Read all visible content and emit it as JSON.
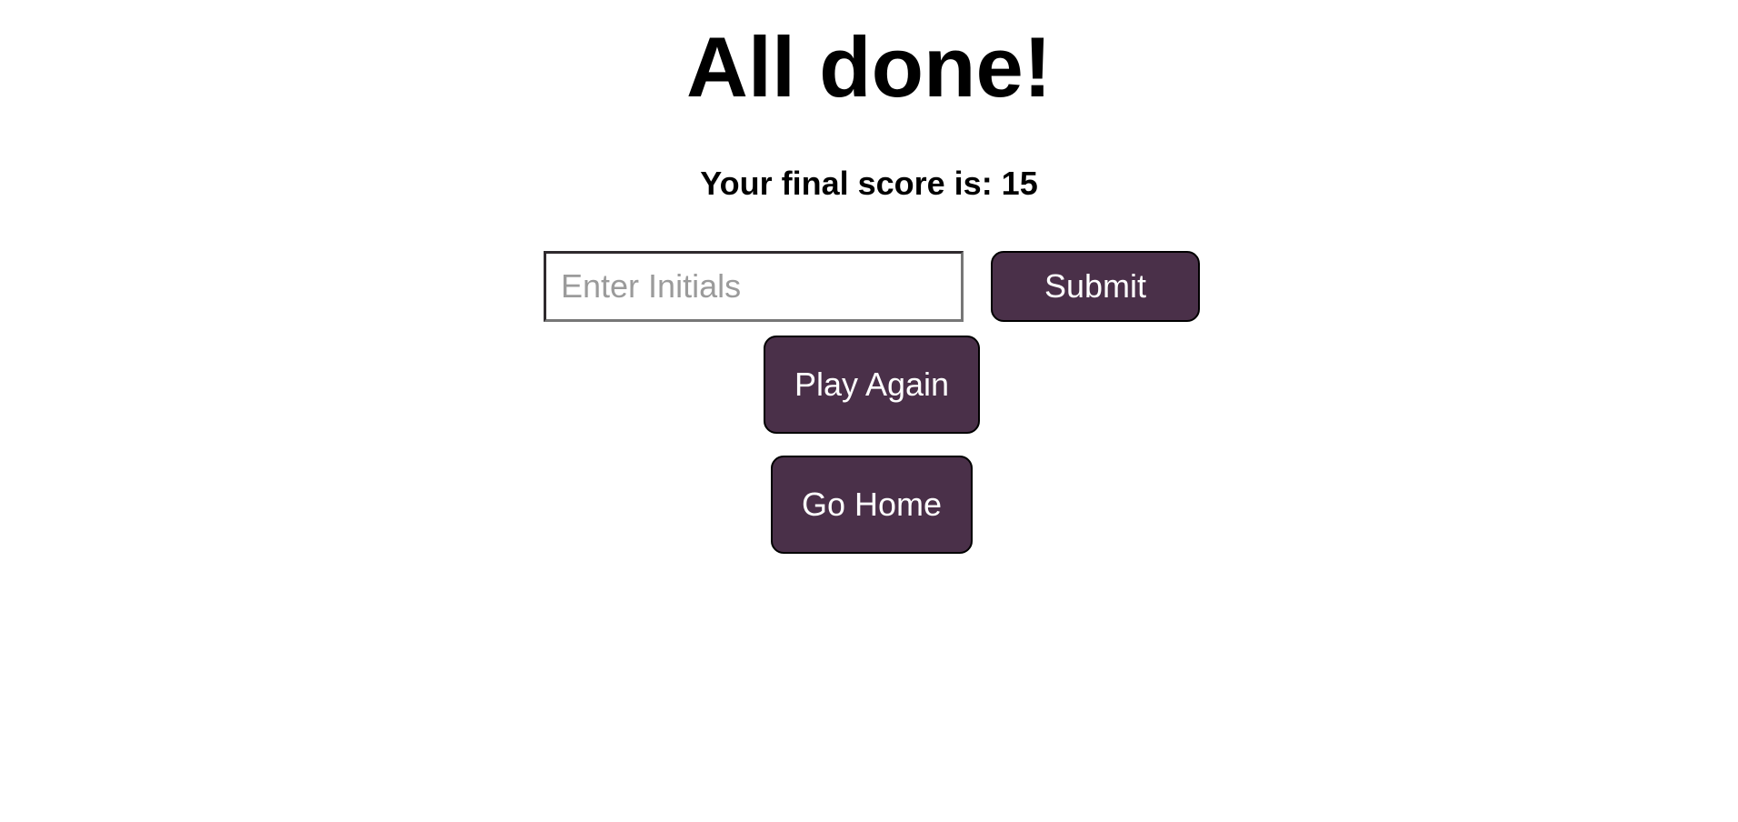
{
  "header": {
    "title": "All done!"
  },
  "result": {
    "score_text": "Your final score is: 15"
  },
  "form": {
    "initials_value": "",
    "initials_placeholder": "Enter Initials",
    "submit_label": "Submit"
  },
  "actions": {
    "play_again_label": "Play Again",
    "go_home_label": "Go Home"
  },
  "colors": {
    "button_bg": "#4a3049",
    "button_text": "#ffffff",
    "placeholder": "#9b9b9b"
  }
}
